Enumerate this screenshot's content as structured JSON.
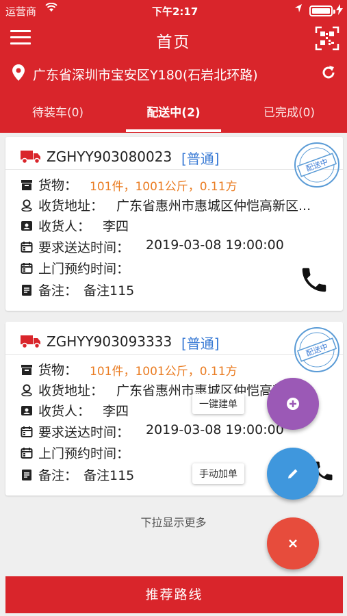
{
  "status_bar": {
    "carrier": "运营商",
    "time": "下午2:17"
  },
  "nav": {
    "title": "首页"
  },
  "location": {
    "address": "广东省深圳市宝安区Y180(石岩北环路)"
  },
  "tabs": [
    {
      "label": "待装车(0)"
    },
    {
      "label": "配送中(2)"
    },
    {
      "label": "已完成(0)"
    }
  ],
  "labels": {
    "cargo": "货物：",
    "address": "收货地址：",
    "receiver": "收货人：",
    "deadline": "要求送达时间：",
    "appointment": "上门预约时间：",
    "remark": "备注："
  },
  "orders": [
    {
      "order_no": "ZGHYY903080023",
      "type": "[普通]",
      "stamp": "配送中",
      "cargo": "101件，1001公斤，0.11方",
      "address": "广东省惠州市惠城区仲恺高新区...",
      "receiver": "李四",
      "deadline": "2019-03-08 19:00:00",
      "appointment": "",
      "remark": "备注115"
    },
    {
      "order_no": "ZGHYY903093333",
      "type": "[普通]",
      "stamp": "配送中",
      "cargo": "101件，1001公斤，0.11方",
      "address": "广东省惠州市惠城区仲恺高新区...",
      "receiver": "李四",
      "deadline": "2019-03-08 19:00:00",
      "appointment": "",
      "remark": "备注115"
    }
  ],
  "hint": "下拉显示更多",
  "fab_menu": {
    "create_label": "一键建单",
    "edit_label": "手动加单"
  },
  "bottom_button": "推荐路线",
  "colors": {
    "primary": "#d9252b",
    "order_type": "#3a7bd5",
    "cargo_text": "#ea7c22",
    "fab_create": "#9b59b6",
    "fab_edit": "#3f97dd",
    "fab_close": "#e74c3c"
  }
}
